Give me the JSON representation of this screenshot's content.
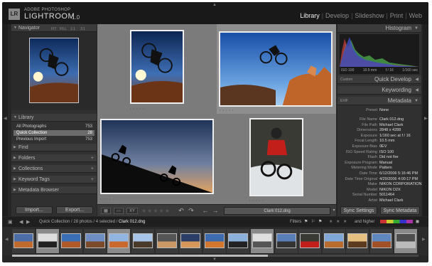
{
  "header": {
    "logo": "LR",
    "brand_line1": "ADOBE PHOTOSHOP",
    "brand_line2": "LIGHTROOM",
    "version": "1.0",
    "modules": [
      "Library",
      "Develop",
      "Slideshow",
      "Print",
      "Web"
    ],
    "active_module": "Library",
    "separator": "|"
  },
  "left_panel": {
    "navigator": {
      "title": "Navigator",
      "options": [
        "FIT",
        "FILL",
        "1:1",
        "3:1"
      ]
    },
    "library": {
      "title": "Library",
      "items": [
        {
          "label": "All Photographs",
          "count": "753"
        },
        {
          "label": "Quick Collection",
          "count": "28",
          "selected": true
        },
        {
          "label": "Previous Import",
          "count": "753"
        }
      ]
    },
    "sections": [
      "Find",
      "Folders",
      "Collections",
      "Keyword Tags",
      "Metadata Browser"
    ],
    "plus": "+",
    "import_label": "Import...",
    "export_label": "Export..."
  },
  "toolbar": {
    "grid": "▦",
    "loupe": "▭",
    "compare": "XY",
    "stars": "★★★★★",
    "rotate_left": "↶",
    "rotate_right": "↷",
    "prev": "←",
    "next": "→",
    "filename": "Clark 012.dng",
    "dropdown": "▾"
  },
  "right_panel": {
    "histogram": {
      "title": "Histogram",
      "iso": "ISO 100",
      "focal": "10.5 mm",
      "aperture": "f / 16",
      "shutter": "1/160 sec"
    },
    "quick_develop": {
      "preset": "Custom",
      "title": "Quick Develop"
    },
    "keywording": {
      "title": "Keywording"
    },
    "metadata": {
      "preset_sel": "EXIF",
      "title": "Metadata",
      "preset_label": "Preset",
      "preset_value": "None",
      "rows": [
        {
          "k": "File Name",
          "v": "Clark 012.dng"
        },
        {
          "k": "File Path",
          "v": "Michael Clark"
        },
        {
          "k": "Dimensions",
          "v": "2848 x 4288"
        },
        {
          "k": "Exposure",
          "v": "1/160 sec at f / 16"
        },
        {
          "k": "Focal Length",
          "v": "10.5 mm"
        },
        {
          "k": "Exposure Bias",
          "v": "0EV"
        },
        {
          "k": "ISO Speed Rating",
          "v": "ISO 100"
        },
        {
          "k": "Flash",
          "v": "Did not fire"
        },
        {
          "k": "Exposure Program",
          "v": "Manual"
        },
        {
          "k": "Metering Mode",
          "v": "Pattern"
        },
        {
          "k": "Date Time",
          "v": "6/12/2006 5:16:46 PM"
        },
        {
          "k": "Date Time Original",
          "v": "4/29/2006 4:00:17 PM"
        },
        {
          "k": "Make",
          "v": "NIKON CORPORATION"
        },
        {
          "k": "Model",
          "v": "NIKON D2X"
        },
        {
          "k": "Serial Number",
          "v": "5011464"
        },
        {
          "k": "Artist",
          "v": "Michael Clark"
        }
      ]
    },
    "sync_settings": "Sync Settings",
    "sync_metadata": "Sync Metadata"
  },
  "filmstrip": {
    "path": "Quick Collection / 28 photos / 4 selected /",
    "current_file": "Clark 012.dng",
    "filters_label": "Filters",
    "and_higher": "and higher",
    "star": "★",
    "count_visible": 17
  },
  "colors": {
    "accent": "#e0e0e0",
    "panel": "#303030",
    "grid_bg": "#707070",
    "selected": "#6b6b6b"
  }
}
